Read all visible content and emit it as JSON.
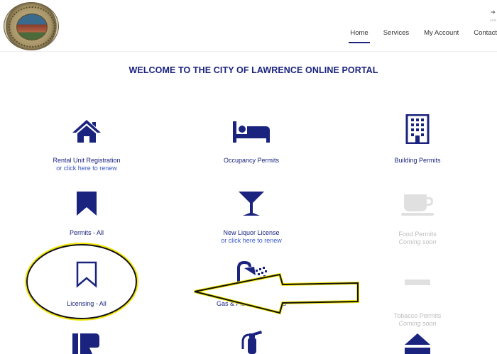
{
  "header": {
    "logout_label": "LOG",
    "nav": [
      {
        "label": "Home",
        "active": true
      },
      {
        "label": "Services",
        "active": false
      },
      {
        "label": "My Account",
        "active": false
      },
      {
        "label": "Contact",
        "active": false
      }
    ]
  },
  "welcome_title": "WELCOME TO THE CITY OF LAWRENCE ONLINE PORTAL",
  "tiles": {
    "rental": {
      "label": "Rental Unit Registration",
      "sub": "or click here to renew",
      "icon": "house-icon"
    },
    "occupancy": {
      "label": "Occupancy Permits",
      "icon": "bed-icon"
    },
    "building": {
      "label": "Building Permits",
      "icon": "building-icon"
    },
    "permits_all": {
      "label": "Permits - All",
      "icon": "bookmark-filled-icon"
    },
    "liquor": {
      "label": "New Liquor License",
      "sub": "or click here to renew",
      "icon": "cocktail-glass-icon"
    },
    "food": {
      "label": "Food Permits",
      "sub": "Coming soon",
      "icon": "coffee-cup-icon"
    },
    "licensing": {
      "label": "Licensing - All",
      "icon": "bookmark-outline-icon"
    },
    "gas": {
      "label": "Gas & Plumbing Permits",
      "icon": "shower-icon"
    },
    "tobacco": {
      "label": "Tobacco Permits",
      "sub": "Coming soon",
      "icon": "tobacco-icon"
    },
    "row4": [
      {
        "icon": "thumbs-down-icon"
      },
      {
        "icon": "fire-extinguisher-icon"
      },
      {
        "icon": "eject-icon"
      }
    ]
  },
  "colors": {
    "primary": "#1a237e",
    "link": "#3a58c5",
    "disabled": "#bdbdbd",
    "highlight": "#f3e600"
  }
}
